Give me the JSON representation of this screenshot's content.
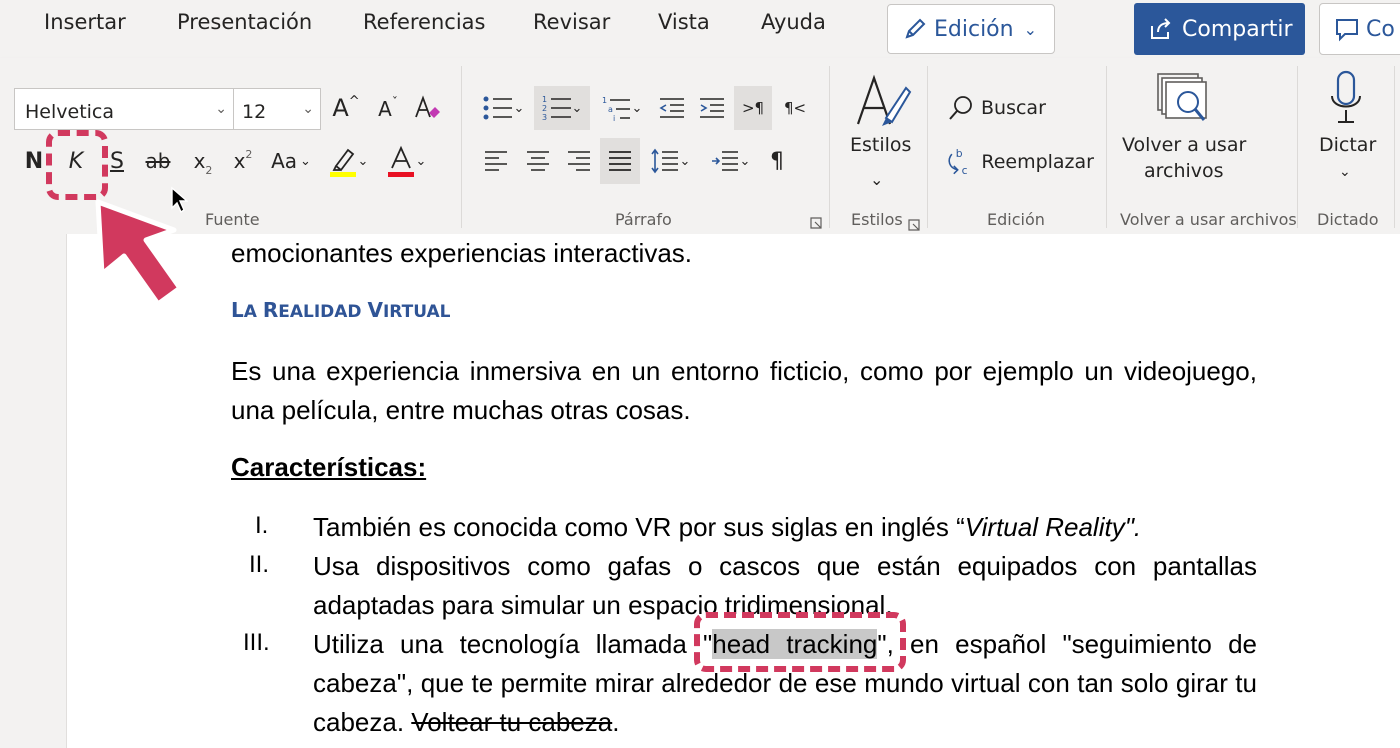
{
  "tabs": [
    "Insertar",
    "Presentación",
    "Referencias",
    "Revisar",
    "Vista",
    "Ayuda"
  ],
  "header": {
    "edicion_label": "Edición",
    "compartir_label": "Compartir",
    "comentarios_label": "Co"
  },
  "font": {
    "family_value": "Helvetica",
    "size_value": "12",
    "bold_label": "N",
    "italic_label": "K",
    "underline_label": "S",
    "strike_label": "ab",
    "sub_label": "x",
    "sub_mark": "2",
    "super_label": "x",
    "super_mark": "2",
    "case_label": "Aa",
    "group_label": "Fuente",
    "grow_label": "A",
    "shrink_label": "A",
    "highlight_color": "#ffff00",
    "font_color": "#e81123"
  },
  "paragraph": {
    "group_label": "Párrafo"
  },
  "styles": {
    "label": "Estilos",
    "group_label": "Estilos"
  },
  "editing": {
    "buscar": "Buscar",
    "reemplazar": "Reemplazar",
    "group_label": "Edición"
  },
  "reuse": {
    "line1": "Volver a usar",
    "line2": "archivos",
    "group_label": "Volver a usar archivos"
  },
  "dictation": {
    "label": "Dictar",
    "group_label": "Dictado"
  },
  "document": {
    "intro_line": "emocionantes experiencias interactivas.",
    "heading_first": "L",
    "heading_a": "A ",
    "heading_r": "R",
    "heading_rest1": "EALIDAD ",
    "heading_v": "V",
    "heading_rest2": "IRTUAL",
    "paragraph": "Es una experiencia inmersiva en un entorno ficticio, como por ejemplo un videojuego, una película, entre muchas otras cosas.",
    "subheading": "Características:",
    "items": [
      {
        "num": "I.",
        "pre": "También es conocida como VR por sus siglas en inglés “",
        "italic": "Virtual Reality\".",
        "post": ""
      },
      {
        "num": "II.",
        "text": "Usa dispositivos como gafas o cascos que están equipados con pantallas adaptadas para simular un espacio tridimensional."
      },
      {
        "num": "III.",
        "pre": "Utiliza una tecnología llamada \"",
        "highlight": "head tracking",
        "post": "\", en español \"seguimiento de cabeza\", que te permite mirar alrededor de ese mundo virtual con tan solo girar tu cabeza. ",
        "strike": "Voltear tu cabeza",
        "end": "."
      }
    ]
  },
  "colors": {
    "accent": "#2b579a",
    "annotation": "#d1395e",
    "heading": "#2f5496"
  }
}
